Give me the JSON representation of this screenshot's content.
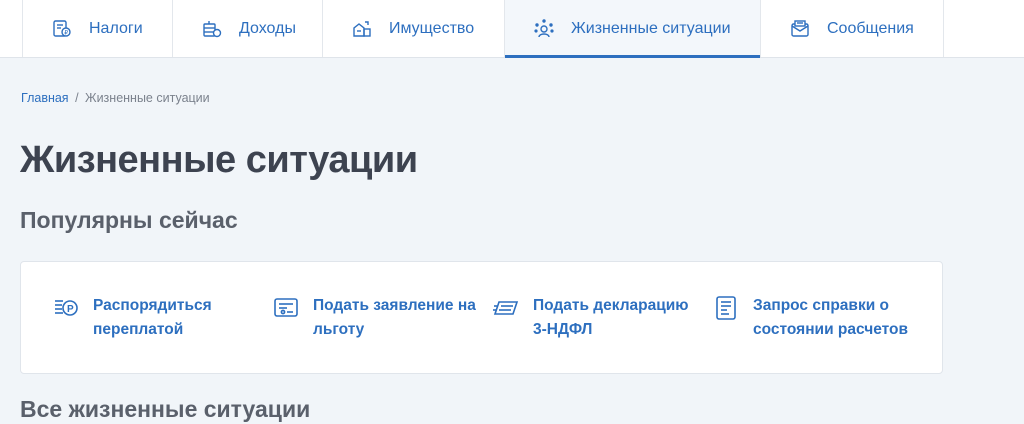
{
  "nav": {
    "tabs": [
      {
        "label": "Налоги",
        "icon": "taxes-icon"
      },
      {
        "label": "Доходы",
        "icon": "income-icon"
      },
      {
        "label": "Имущество",
        "icon": "property-icon"
      },
      {
        "label": "Жизненные ситуации",
        "icon": "life-situations-icon",
        "active": true
      },
      {
        "label": "Сообщения",
        "icon": "messages-icon"
      }
    ]
  },
  "breadcrumb": {
    "home": "Главная",
    "separator": "/",
    "current": "Жизненные ситуации"
  },
  "page": {
    "title": "Жизненные ситуации"
  },
  "popular": {
    "title": "Популярны сейчас",
    "items": [
      {
        "label": "Распорядиться переплатой",
        "icon": "overpayment-icon"
      },
      {
        "label": "Подать заявление на льготу",
        "icon": "benefit-application-icon"
      },
      {
        "label": "Подать декларацию 3-НДФЛ",
        "icon": "declaration-icon"
      },
      {
        "label": "Запрос справки о состоянии расчетов",
        "icon": "certificate-request-icon"
      }
    ]
  },
  "all": {
    "title": "Все жизненные ситуации"
  },
  "colors": {
    "accent": "#2d6fbf",
    "background": "#f1f5f9",
    "text": "#3d4350"
  }
}
